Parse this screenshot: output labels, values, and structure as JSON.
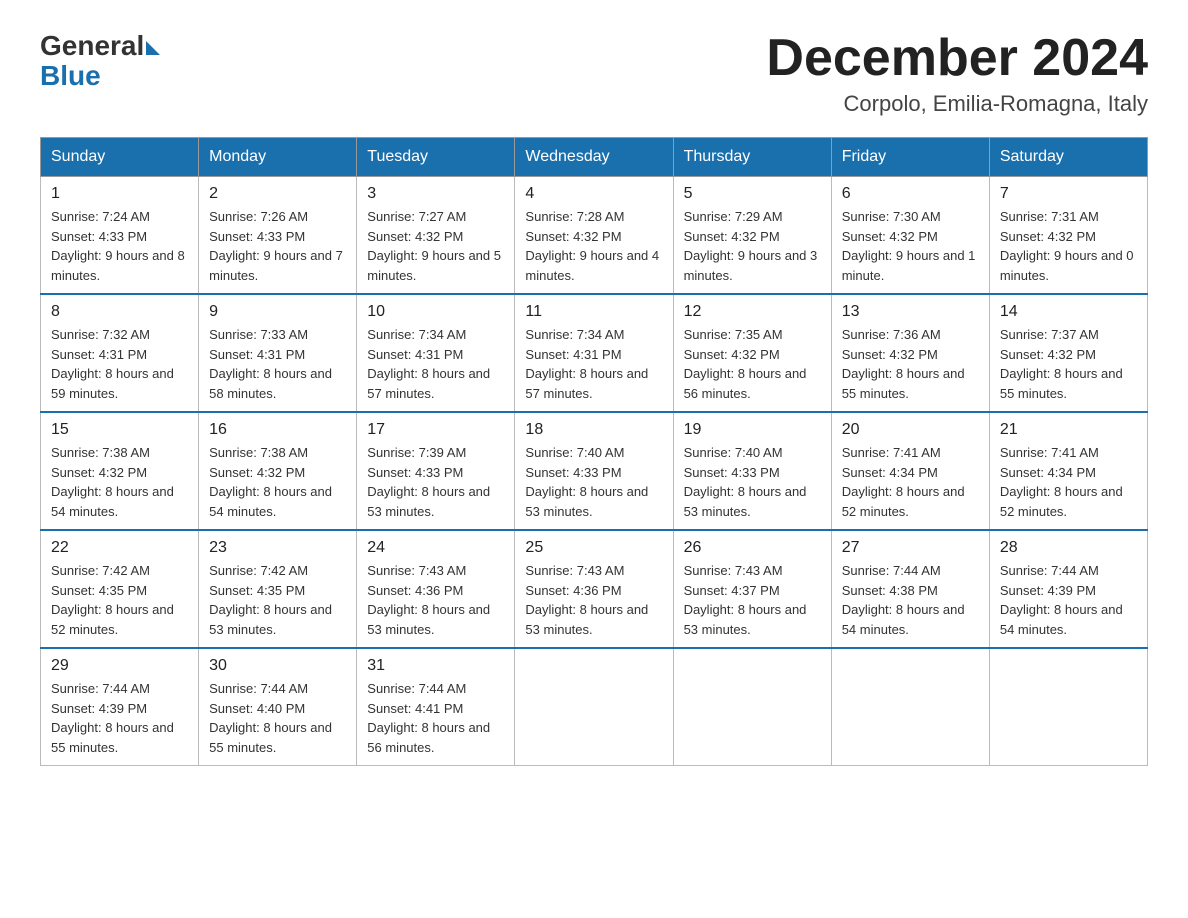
{
  "logo": {
    "general": "General",
    "blue": "Blue"
  },
  "title": "December 2024",
  "location": "Corpolo, Emilia-Romagna, Italy",
  "days_of_week": [
    "Sunday",
    "Monday",
    "Tuesday",
    "Wednesday",
    "Thursday",
    "Friday",
    "Saturday"
  ],
  "weeks": [
    [
      {
        "day": "1",
        "sunrise": "7:24 AM",
        "sunset": "4:33 PM",
        "daylight": "9 hours and 8 minutes."
      },
      {
        "day": "2",
        "sunrise": "7:26 AM",
        "sunset": "4:33 PM",
        "daylight": "9 hours and 7 minutes."
      },
      {
        "day": "3",
        "sunrise": "7:27 AM",
        "sunset": "4:32 PM",
        "daylight": "9 hours and 5 minutes."
      },
      {
        "day": "4",
        "sunrise": "7:28 AM",
        "sunset": "4:32 PM",
        "daylight": "9 hours and 4 minutes."
      },
      {
        "day": "5",
        "sunrise": "7:29 AM",
        "sunset": "4:32 PM",
        "daylight": "9 hours and 3 minutes."
      },
      {
        "day": "6",
        "sunrise": "7:30 AM",
        "sunset": "4:32 PM",
        "daylight": "9 hours and 1 minute."
      },
      {
        "day": "7",
        "sunrise": "7:31 AM",
        "sunset": "4:32 PM",
        "daylight": "9 hours and 0 minutes."
      }
    ],
    [
      {
        "day": "8",
        "sunrise": "7:32 AM",
        "sunset": "4:31 PM",
        "daylight": "8 hours and 59 minutes."
      },
      {
        "day": "9",
        "sunrise": "7:33 AM",
        "sunset": "4:31 PM",
        "daylight": "8 hours and 58 minutes."
      },
      {
        "day": "10",
        "sunrise": "7:34 AM",
        "sunset": "4:31 PM",
        "daylight": "8 hours and 57 minutes."
      },
      {
        "day": "11",
        "sunrise": "7:34 AM",
        "sunset": "4:31 PM",
        "daylight": "8 hours and 57 minutes."
      },
      {
        "day": "12",
        "sunrise": "7:35 AM",
        "sunset": "4:32 PM",
        "daylight": "8 hours and 56 minutes."
      },
      {
        "day": "13",
        "sunrise": "7:36 AM",
        "sunset": "4:32 PM",
        "daylight": "8 hours and 55 minutes."
      },
      {
        "day": "14",
        "sunrise": "7:37 AM",
        "sunset": "4:32 PM",
        "daylight": "8 hours and 55 minutes."
      }
    ],
    [
      {
        "day": "15",
        "sunrise": "7:38 AM",
        "sunset": "4:32 PM",
        "daylight": "8 hours and 54 minutes."
      },
      {
        "day": "16",
        "sunrise": "7:38 AM",
        "sunset": "4:32 PM",
        "daylight": "8 hours and 54 minutes."
      },
      {
        "day": "17",
        "sunrise": "7:39 AM",
        "sunset": "4:33 PM",
        "daylight": "8 hours and 53 minutes."
      },
      {
        "day": "18",
        "sunrise": "7:40 AM",
        "sunset": "4:33 PM",
        "daylight": "8 hours and 53 minutes."
      },
      {
        "day": "19",
        "sunrise": "7:40 AM",
        "sunset": "4:33 PM",
        "daylight": "8 hours and 53 minutes."
      },
      {
        "day": "20",
        "sunrise": "7:41 AM",
        "sunset": "4:34 PM",
        "daylight": "8 hours and 52 minutes."
      },
      {
        "day": "21",
        "sunrise": "7:41 AM",
        "sunset": "4:34 PM",
        "daylight": "8 hours and 52 minutes."
      }
    ],
    [
      {
        "day": "22",
        "sunrise": "7:42 AM",
        "sunset": "4:35 PM",
        "daylight": "8 hours and 52 minutes."
      },
      {
        "day": "23",
        "sunrise": "7:42 AM",
        "sunset": "4:35 PM",
        "daylight": "8 hours and 53 minutes."
      },
      {
        "day": "24",
        "sunrise": "7:43 AM",
        "sunset": "4:36 PM",
        "daylight": "8 hours and 53 minutes."
      },
      {
        "day": "25",
        "sunrise": "7:43 AM",
        "sunset": "4:36 PM",
        "daylight": "8 hours and 53 minutes."
      },
      {
        "day": "26",
        "sunrise": "7:43 AM",
        "sunset": "4:37 PM",
        "daylight": "8 hours and 53 minutes."
      },
      {
        "day": "27",
        "sunrise": "7:44 AM",
        "sunset": "4:38 PM",
        "daylight": "8 hours and 54 minutes."
      },
      {
        "day": "28",
        "sunrise": "7:44 AM",
        "sunset": "4:39 PM",
        "daylight": "8 hours and 54 minutes."
      }
    ],
    [
      {
        "day": "29",
        "sunrise": "7:44 AM",
        "sunset": "4:39 PM",
        "daylight": "8 hours and 55 minutes."
      },
      {
        "day": "30",
        "sunrise": "7:44 AM",
        "sunset": "4:40 PM",
        "daylight": "8 hours and 55 minutes."
      },
      {
        "day": "31",
        "sunrise": "7:44 AM",
        "sunset": "4:41 PM",
        "daylight": "8 hours and 56 minutes."
      },
      null,
      null,
      null,
      null
    ]
  ],
  "sunrise_label": "Sunrise:",
  "sunset_label": "Sunset:",
  "daylight_label": "Daylight:"
}
